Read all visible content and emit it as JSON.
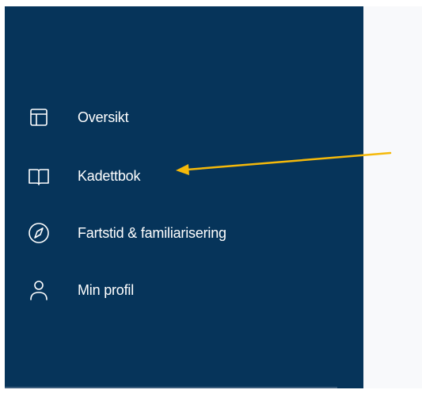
{
  "sidebar": {
    "items": [
      {
        "label": "Oversikt",
        "icon": "layout-icon"
      },
      {
        "label": "Kadettbok",
        "icon": "book-icon"
      },
      {
        "label": "Fartstid & familiarisering",
        "icon": "compass-icon"
      },
      {
        "label": "Min profil",
        "icon": "user-icon"
      }
    ]
  },
  "colors": {
    "sidebar_bg": "#06345a",
    "label_text": "#ffffff",
    "annotation_arrow": "#f5b90a"
  }
}
